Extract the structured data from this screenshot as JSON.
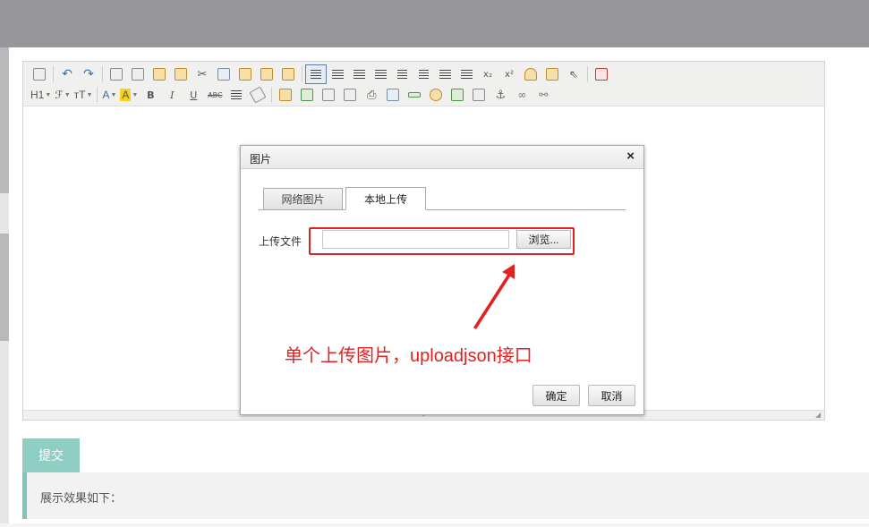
{
  "editor": {
    "toolbar_row1": [
      "source-icon",
      "undo-icon",
      "redo-icon",
      "preview-icon",
      "print-icon",
      "template-icon",
      "code-icon",
      "cut-icon",
      "copy-icon",
      "paste-icon",
      "paste-plain-icon",
      "paste-word-icon",
      "align-left-icon",
      "align-center-icon",
      "align-right-icon",
      "align-justify-icon",
      "ordered-list-icon",
      "unordered-list-icon",
      "indent-icon",
      "outdent-icon",
      "subscript-icon",
      "superscript-icon",
      "clear-format-icon",
      "quick-format-icon",
      "select-all-icon",
      "fullscreen-icon"
    ],
    "toolbar_row2": {
      "heading_label": "H1",
      "font_label": "ℱ",
      "fontsize_label": "тT",
      "forecolor_label": "A",
      "hilite_label": "A",
      "bold_label": "B",
      "italic_label": "I",
      "underline_label": "U",
      "strike_label": "ABC",
      "icons": [
        "line-height-icon",
        "remove-format-icon",
        "image-icon",
        "multi-image-icon",
        "flash-icon",
        "media-icon",
        "attachment-icon",
        "table-icon",
        "hr-icon",
        "emoticons-icon",
        "baidu-map-icon",
        "pagebreak-icon",
        "anchor-icon",
        "link-icon",
        "unlink-icon"
      ]
    }
  },
  "dialog": {
    "title": "图片",
    "close_glyph": "×",
    "tab_network": "网络图片",
    "tab_local": "本地上传",
    "upload_label": "上传文件",
    "browse_label": "浏览...",
    "ok_label": "确定",
    "cancel_label": "取消"
  },
  "annotation": {
    "text": "单个上传图片，uploadjson接口",
    "color": "#e02222"
  },
  "page": {
    "submit_label": "提交",
    "result_label": "展示效果如下：",
    "accent_color": "#8fcfc3"
  }
}
